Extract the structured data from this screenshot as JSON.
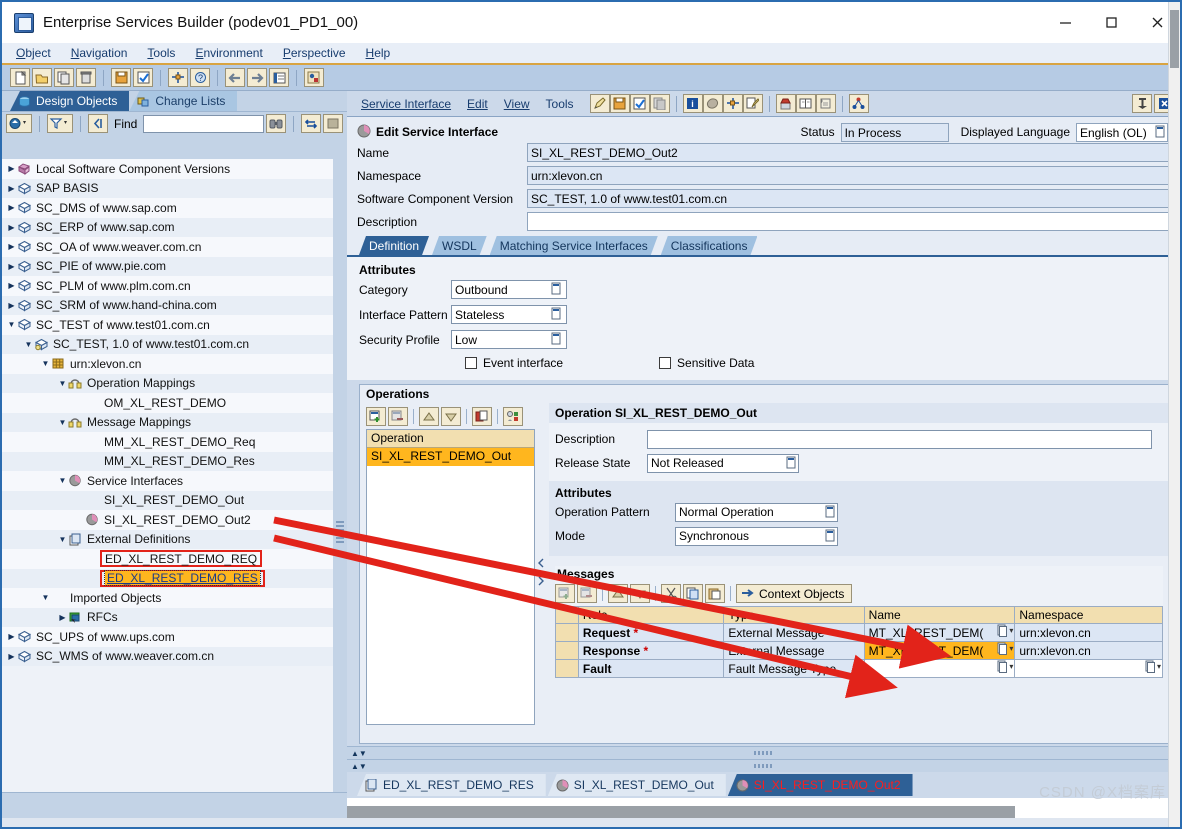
{
  "window": {
    "title": "Enterprise Services Builder (podev01_PD1_00)",
    "icon": "app-icon",
    "minimize": "—",
    "maximize": "□",
    "close": "✕"
  },
  "menubar": {
    "items": [
      {
        "label": "Object",
        "accel": "O"
      },
      {
        "label": "Navigation",
        "accel": "N"
      },
      {
        "label": "Tools",
        "accel": "T"
      },
      {
        "label": "Environment",
        "accel": "E"
      },
      {
        "label": "Perspective",
        "accel": "P"
      },
      {
        "label": "Help",
        "accel": "H"
      }
    ]
  },
  "toolbar": {
    "buttons": [
      "new-icon",
      "open-icon",
      "copy-icon",
      "delete-icon",
      "save-icon",
      "activate-icon",
      "where-used-icon",
      "check-icon",
      "back-icon",
      "forward-icon",
      "list-icon",
      "history-icon"
    ]
  },
  "left": {
    "tabs": [
      {
        "label": "Design Objects",
        "icon": "design-objects-icon",
        "active": true
      },
      {
        "label": "Change Lists",
        "icon": "change-lists-icon",
        "active": false
      }
    ],
    "find": {
      "label": "Find",
      "value": "",
      "placeholder": "",
      "buttons": [
        "refresh-icon",
        "filter-icon",
        "collapse-icon",
        "binoculars-icon",
        "sync-icon",
        "stop-icon"
      ]
    },
    "tree": [
      {
        "label": "Local Software Component Versions",
        "indent": 0,
        "arrow": "collapsed",
        "icon": "swcv-stack-icon"
      },
      {
        "label": "SAP BASIS",
        "indent": 0,
        "arrow": "collapsed",
        "icon": "cube-icon"
      },
      {
        "label": "SC_DMS of www.sap.com",
        "indent": 0,
        "arrow": "collapsed",
        "icon": "cube-icon"
      },
      {
        "label": "SC_ERP of www.sap.com",
        "indent": 0,
        "arrow": "collapsed",
        "icon": "cube-icon"
      },
      {
        "label": "SC_OA of www.weaver.com.cn",
        "indent": 0,
        "arrow": "collapsed",
        "icon": "cube-icon"
      },
      {
        "label": "SC_PIE of www.pie.com",
        "indent": 0,
        "arrow": "collapsed",
        "icon": "cube-icon"
      },
      {
        "label": "SC_PLM of www.plm.com.cn",
        "indent": 0,
        "arrow": "collapsed",
        "icon": "cube-icon"
      },
      {
        "label": "SC_SRM of www.hand-china.com",
        "indent": 0,
        "arrow": "collapsed",
        "icon": "cube-icon"
      },
      {
        "label": "SC_TEST of www.test01.com.cn",
        "indent": 0,
        "arrow": "expanded",
        "icon": "cube-icon"
      },
      {
        "label": "SC_TEST, 1.0 of www.test01.com.cn",
        "indent": 1,
        "arrow": "expanded",
        "icon": "swcv-icon"
      },
      {
        "label": "urn:xlevon.cn",
        "indent": 2,
        "arrow": "expanded",
        "icon": "namespace-icon"
      },
      {
        "label": "Operation Mappings",
        "indent": 3,
        "arrow": "expanded",
        "icon": "operation-mapping-icon"
      },
      {
        "label": "OM_XL_REST_DEMO",
        "indent": 4,
        "arrow": "none",
        "icon": "none"
      },
      {
        "label": "Message Mappings",
        "indent": 3,
        "arrow": "expanded",
        "icon": "message-mapping-icon"
      },
      {
        "label": "MM_XL_REST_DEMO_Req",
        "indent": 4,
        "arrow": "none",
        "icon": "none"
      },
      {
        "label": "MM_XL_REST_DEMO_Res",
        "indent": 4,
        "arrow": "none",
        "icon": "none"
      },
      {
        "label": "Service Interfaces",
        "indent": 3,
        "arrow": "expanded",
        "icon": "service-interface-icon"
      },
      {
        "label": "SI_XL_REST_DEMO_Out",
        "indent": 4,
        "arrow": "none",
        "icon": "none"
      },
      {
        "label": "SI_XL_REST_DEMO_Out2",
        "indent": 4,
        "arrow": "none",
        "icon": "service-interface-icon"
      },
      {
        "label": "External Definitions",
        "indent": 3,
        "arrow": "expanded",
        "icon": "external-definition-icon"
      },
      {
        "label": "ED_XL_REST_DEMO_REQ",
        "indent": 4,
        "arrow": "none",
        "icon": "none",
        "highlighted": true
      },
      {
        "label": "ED_XL_REST_DEMO_RES",
        "indent": 4,
        "arrow": "none",
        "icon": "none",
        "highlighted": true,
        "selected": true
      },
      {
        "label": "Imported Objects",
        "indent": 2,
        "arrow": "expanded",
        "icon": "none"
      },
      {
        "label": "RFCs",
        "indent": 3,
        "arrow": "collapsed",
        "icon": "rfc-icon"
      },
      {
        "label": "SC_UPS of www.ups.com",
        "indent": 0,
        "arrow": "collapsed",
        "icon": "cube-icon"
      },
      {
        "label": "SC_WMS of www.weaver.com.cn",
        "indent": 0,
        "arrow": "collapsed",
        "icon": "cube-icon"
      }
    ]
  },
  "right": {
    "menubar": [
      "Service Interface",
      "Edit",
      "View",
      "Tools"
    ],
    "toolbar_icons": [
      "edit-icon",
      "save-icon",
      "activate-icon",
      "copy-icon",
      "info-icon",
      "shield-icon",
      "where-used-icon",
      "check-icon",
      "export-icon",
      "book-icon",
      "scroll-icon",
      "dependency-icon"
    ],
    "corner_icons": [
      "pin-icon",
      "close-icon"
    ],
    "header": {
      "icon": "service-interface-icon",
      "title": "Edit Service Interface",
      "status_label": "Status",
      "status_value": "In Process",
      "language_label": "Displayed Language",
      "language_value": "English (OL)",
      "fields": [
        {
          "label": "Name",
          "value": "SI_XL_REST_DEMO_Out2"
        },
        {
          "label": "Namespace",
          "value": "urn:xlevon.cn"
        },
        {
          "label": "Software Component Version",
          "value": "SC_TEST, 1.0 of www.test01.com.cn"
        },
        {
          "label": "Description",
          "value": ""
        }
      ]
    },
    "tabs": [
      {
        "label": "Definition",
        "active": true
      },
      {
        "label": "WSDL",
        "active": false
      },
      {
        "label": "Matching Service Interfaces",
        "active": false
      },
      {
        "label": "Classifications",
        "active": false
      }
    ],
    "attributes": {
      "title": "Attributes",
      "rows": [
        {
          "label": "Category",
          "value": "Outbound"
        },
        {
          "label": "Interface Pattern",
          "value": "Stateless"
        },
        {
          "label": "Security Profile",
          "value": "Low"
        }
      ],
      "checkboxes": [
        {
          "label": "Event interface",
          "checked": false
        },
        {
          "label": "Sensitive Data",
          "checked": false
        }
      ]
    },
    "operations": {
      "title": "Operations",
      "toolbar_icons": [
        "insert-row-icon",
        "delete-row-icon",
        "move-up-icon",
        "move-down-icon",
        "copy-icon",
        "details-icon"
      ],
      "list_header": "Operation",
      "items": [
        {
          "label": "SI_XL_REST_DEMO_Out",
          "selected": true
        }
      ],
      "detail": {
        "title": "Operation SI_XL_REST_DEMO_Out",
        "fields": [
          {
            "label": "Description",
            "value": ""
          },
          {
            "label": "Release State",
            "value": "Not Released"
          }
        ],
        "attributes_title": "Attributes",
        "attributes": [
          {
            "label": "Operation Pattern",
            "value": "Normal Operation"
          },
          {
            "label": "Mode",
            "value": "Synchronous"
          }
        ]
      },
      "messages": {
        "title": "Messages",
        "toolbar_icons": [
          "insert-row-icon",
          "delete-row-icon",
          "move-up-icon",
          "move-down-icon",
          "cut-icon",
          "copy-icon",
          "paste-icon"
        ],
        "context_button": "Context Objects",
        "columns": [
          "",
          "Role",
          "Type",
          "Name",
          "Namespace"
        ],
        "rows": [
          {
            "role": "Request",
            "required": true,
            "type": "External Message",
            "name": "MT_XL_REST_DEM(",
            "namespace": "urn:xlevon.cn",
            "name_highlighted": false
          },
          {
            "role": "Response",
            "required": true,
            "type": "External Message",
            "name": "MT_XL_REST_DEM(",
            "namespace": "urn:xlevon.cn",
            "name_highlighted": true
          },
          {
            "role": "Fault",
            "required": false,
            "type": "Fault Message Type",
            "name": "",
            "namespace": "",
            "name_highlighted": false
          }
        ]
      }
    },
    "doc_tabs": [
      {
        "label": "ED_XL_REST_DEMO_RES",
        "icon": "external-definition-icon",
        "active": false
      },
      {
        "label": "SI_XL_REST_DEMO_Out",
        "icon": "service-interface-icon",
        "active": false
      },
      {
        "label": "SI_XL_REST_DEMO_Out2",
        "icon": "service-interface-icon",
        "active": true
      }
    ]
  },
  "watermark": "CSDN @X档案库",
  "colors": {
    "accent_blue": "#2e6096",
    "selection_orange": "#ffb61e",
    "annotation_red": "#e2231a",
    "toolbar_beige": "#f4ecd3",
    "header_tan": "#f2dfb0"
  }
}
